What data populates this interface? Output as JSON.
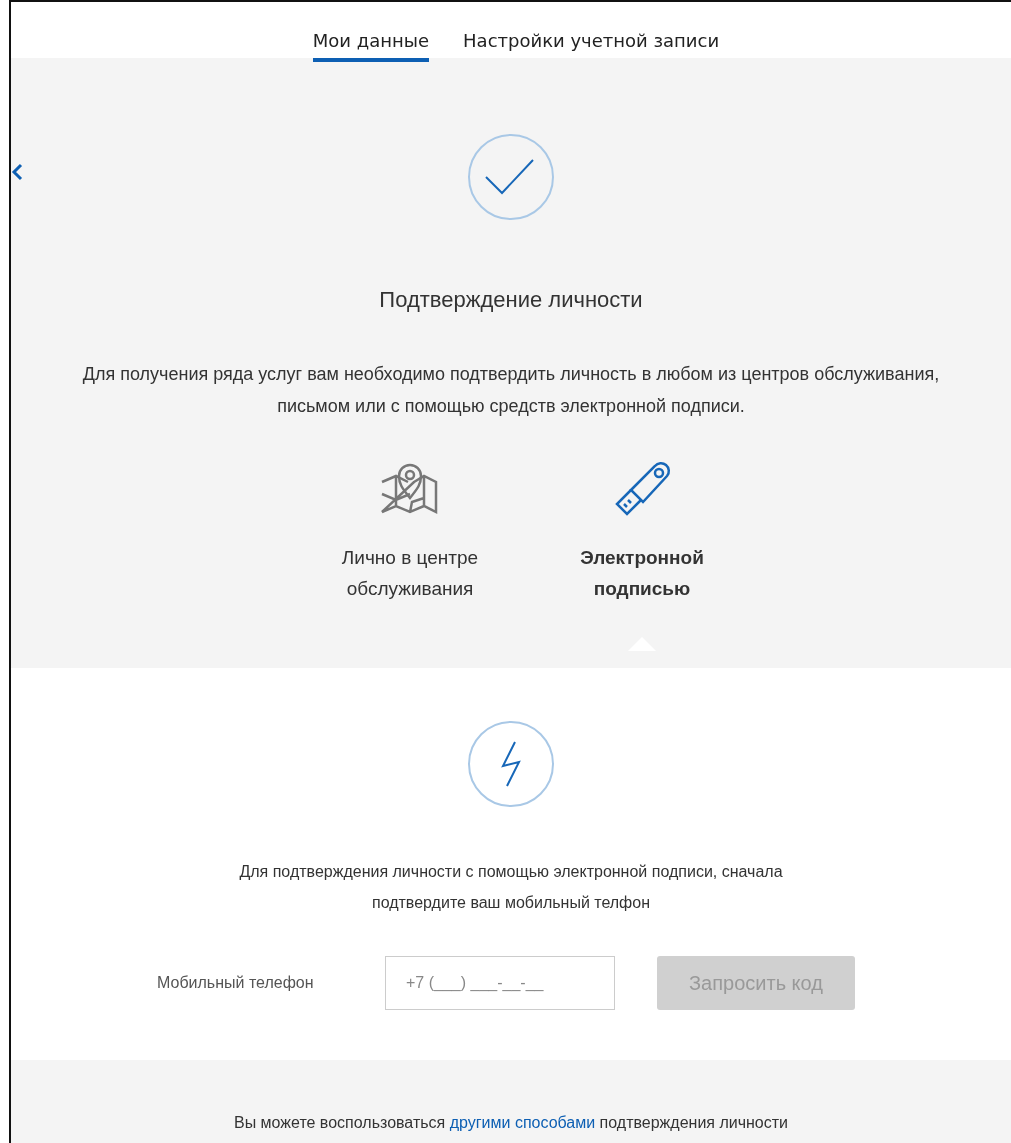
{
  "tabs": [
    {
      "label": "Мои данные",
      "selected": true
    },
    {
      "label": "Настройки учетной записи",
      "selected": false
    }
  ],
  "title": "Подтверждение личности",
  "intro": "Для получения ряда услуг вам необходимо подтвердить личность в любом из центров обслуживания, письмом или с помощью средств электронной подписи.",
  "methods": [
    {
      "kind": "map",
      "label": "Лично в центре обслуживания",
      "selected": false
    },
    {
      "kind": "usb",
      "label": "Электронной подписью",
      "selected": true
    }
  ],
  "panel": {
    "text": "Для подтверждения личности с помощью электронной подписи, сначала подтвердите ваш мобильный телфон",
    "phone_label": "Мобильный телефон",
    "phone_placeholder": "+7 (___) ___-__-__",
    "button": {
      "label": "Запросить код",
      "disabled": true
    }
  },
  "footer": {
    "before": "Вы можете воспользоваться",
    "link": "другими способами",
    "after": "подтверждения личности"
  }
}
